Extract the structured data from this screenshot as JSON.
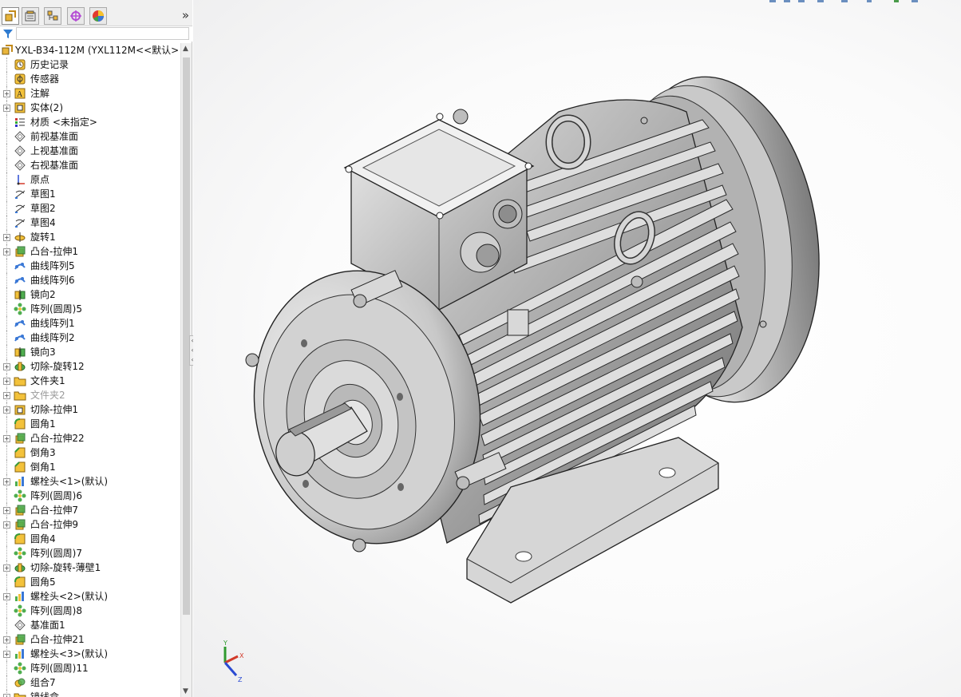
{
  "feature_tree": {
    "tabs": [
      {
        "icon": "feature-manager-icon"
      },
      {
        "icon": "property-manager-icon"
      },
      {
        "icon": "configuration-manager-icon"
      },
      {
        "icon": "dimxpert-icon"
      },
      {
        "icon": "display-manager-icon"
      }
    ],
    "more": "»",
    "root": "YXL-B34-112M  (YXL112M<<默认>",
    "items": [
      {
        "label": "历史记录",
        "icon": "history-icon",
        "exp": false
      },
      {
        "label": "传感器",
        "icon": "sensor-icon",
        "exp": false
      },
      {
        "label": "注解",
        "icon": "annotation-icon",
        "exp": true
      },
      {
        "label": "实体(2)",
        "icon": "solid-bodies-icon",
        "exp": true
      },
      {
        "label": "材质 <未指定>",
        "icon": "material-icon",
        "exp": false
      },
      {
        "label": "前视基准面",
        "icon": "plane-icon",
        "exp": false
      },
      {
        "label": "上视基准面",
        "icon": "plane-icon",
        "exp": false
      },
      {
        "label": "右视基准面",
        "icon": "plane-icon",
        "exp": false
      },
      {
        "label": "原点",
        "icon": "origin-icon",
        "exp": false
      },
      {
        "label": "草图1",
        "icon": "sketch-icon",
        "exp": false
      },
      {
        "label": "草图2",
        "icon": "sketch-icon",
        "exp": false
      },
      {
        "label": "草图4",
        "icon": "sketch-icon",
        "exp": false
      },
      {
        "label": "旋转1",
        "icon": "revolve-icon",
        "exp": true
      },
      {
        "label": "凸台-拉伸1",
        "icon": "extrude-icon",
        "exp": true
      },
      {
        "label": "曲线阵列5",
        "icon": "curve-pattern-icon",
        "exp": false
      },
      {
        "label": "曲线阵列6",
        "icon": "curve-pattern-icon",
        "exp": false
      },
      {
        "label": "镜向2",
        "icon": "mirror-icon",
        "exp": false
      },
      {
        "label": "阵列(圆周)5",
        "icon": "circular-pattern-icon",
        "exp": false
      },
      {
        "label": "曲线阵列1",
        "icon": "curve-pattern-icon",
        "exp": false
      },
      {
        "label": "曲线阵列2",
        "icon": "curve-pattern-icon",
        "exp": false
      },
      {
        "label": "镜向3",
        "icon": "mirror-icon",
        "exp": false
      },
      {
        "label": "切除-旋转12",
        "icon": "cut-revolve-icon",
        "exp": true
      },
      {
        "label": "文件夹1",
        "icon": "folder-icon",
        "exp": true
      },
      {
        "label": "文件夹2",
        "icon": "folder-icon",
        "exp": true,
        "suppressed": true
      },
      {
        "label": "切除-拉伸1",
        "icon": "cut-extrude-icon",
        "exp": true
      },
      {
        "label": "圆角1",
        "icon": "fillet-icon",
        "exp": false
      },
      {
        "label": "凸台-拉伸22",
        "icon": "extrude-icon",
        "exp": true
      },
      {
        "label": "倒角3",
        "icon": "chamfer-icon",
        "exp": false
      },
      {
        "label": "倒角1",
        "icon": "chamfer-icon",
        "exp": false
      },
      {
        "label": "螺栓头<1>(默认)",
        "icon": "library-feature-icon",
        "exp": true
      },
      {
        "label": "阵列(圆周)6",
        "icon": "circular-pattern-icon",
        "exp": false
      },
      {
        "label": "凸台-拉伸7",
        "icon": "extrude-icon",
        "exp": true
      },
      {
        "label": "凸台-拉伸9",
        "icon": "extrude-icon",
        "exp": true
      },
      {
        "label": "圆角4",
        "icon": "fillet-icon",
        "exp": false
      },
      {
        "label": "阵列(圆周)7",
        "icon": "circular-pattern-icon",
        "exp": false
      },
      {
        "label": "切除-旋转-薄壁1",
        "icon": "cut-revolve-icon",
        "exp": true
      },
      {
        "label": "圆角5",
        "icon": "fillet-icon",
        "exp": false
      },
      {
        "label": "螺栓头<2>(默认)",
        "icon": "library-feature-icon",
        "exp": true
      },
      {
        "label": "阵列(圆周)8",
        "icon": "circular-pattern-icon",
        "exp": false
      },
      {
        "label": "基准面1",
        "icon": "plane-icon",
        "exp": false
      },
      {
        "label": "凸台-拉伸21",
        "icon": "extrude-icon",
        "exp": true
      },
      {
        "label": "螺栓头<3>(默认)",
        "icon": "library-feature-icon",
        "exp": true
      },
      {
        "label": "阵列(圆周)11",
        "icon": "circular-pattern-icon",
        "exp": false
      },
      {
        "label": "组合7",
        "icon": "combine-icon",
        "exp": false
      },
      {
        "label": "镜线盒",
        "icon": "folder-icon",
        "exp": true
      }
    ]
  },
  "viewport": {
    "triad": {
      "x": "X",
      "y": "Y",
      "z": "Z"
    }
  }
}
